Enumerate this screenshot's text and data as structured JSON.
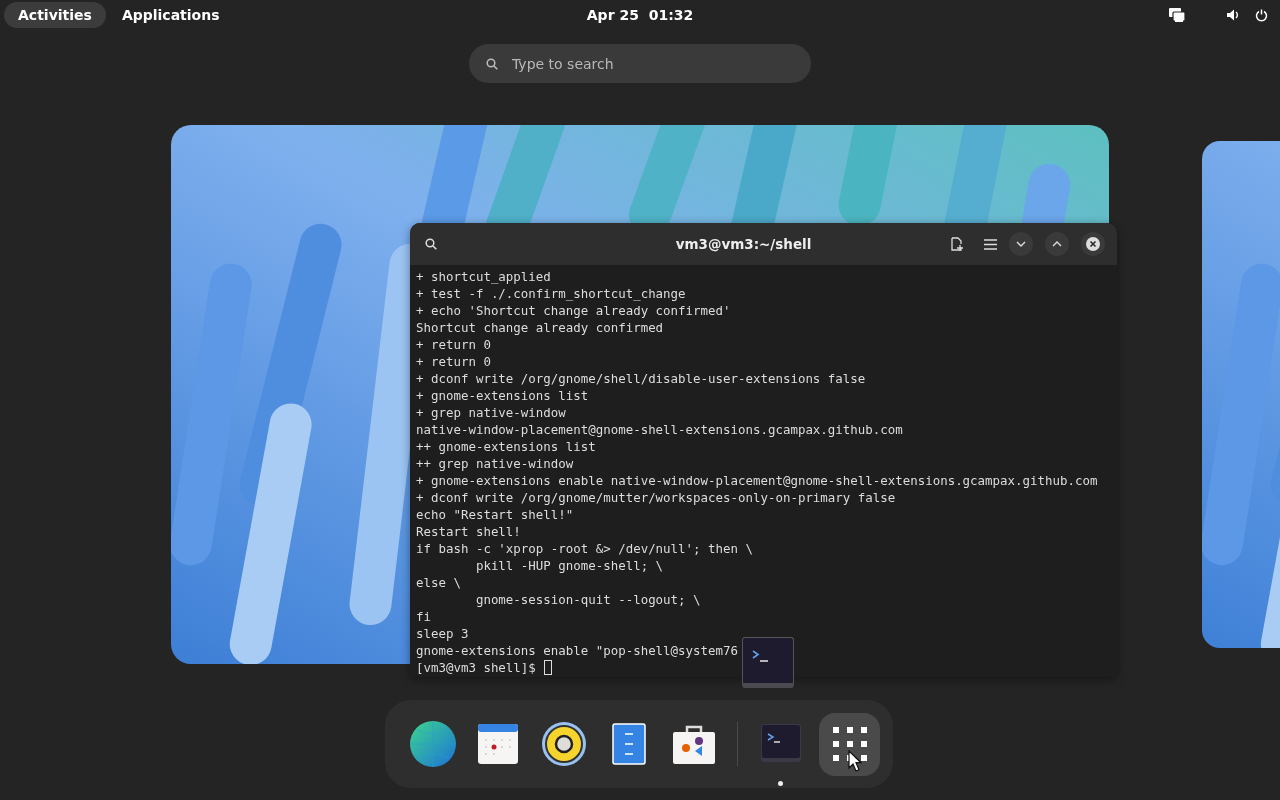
{
  "top_bar": {
    "tabs": [
      {
        "label": "Activities",
        "selected": true
      },
      {
        "label": "Applications",
        "selected": false
      }
    ],
    "clock": "Apr 25  01:32"
  },
  "search": {
    "placeholder": "Type to search"
  },
  "terminal": {
    "title": "vm3@vm3:~/shell",
    "lines": [
      "+ shortcut_applied",
      "+ test -f ./.confirm_shortcut_change",
      "+ echo 'Shortcut change already confirmed'",
      "Shortcut change already confirmed",
      "+ return 0",
      "+ return 0",
      "+ dconf write /org/gnome/shell/disable-user-extensions false",
      "+ gnome-extensions list",
      "+ grep native-window",
      "native-window-placement@gnome-shell-extensions.gcampax.github.com",
      "++ gnome-extensions list",
      "++ grep native-window",
      "+ gnome-extensions enable native-window-placement@gnome-shell-extensions.gcampax.github.com",
      "+ dconf write /org/gnome/mutter/workspaces-only-on-primary false",
      "echo \"Restart shell!\"",
      "Restart shell!",
      "if bash -c 'xprop -root &> /dev/null'; then \\",
      "        pkill -HUP gnome-shell; \\",
      "else \\",
      "        gnome-session-quit --logout; \\",
      "fi",
      "sleep 3",
      "gnome-extensions enable \"pop-shell@system76"
    ],
    "prompt": "[vm3@vm3 shell]$"
  },
  "dock": {
    "apps": [
      {
        "kind": "browser",
        "running": false
      },
      {
        "kind": "calendar",
        "running": false
      },
      {
        "kind": "speaker",
        "running": false
      },
      {
        "kind": "files",
        "running": false
      },
      {
        "kind": "store",
        "running": false
      },
      {
        "kind": "separator"
      },
      {
        "kind": "terminal",
        "running": true
      },
      {
        "kind": "grid"
      }
    ]
  }
}
